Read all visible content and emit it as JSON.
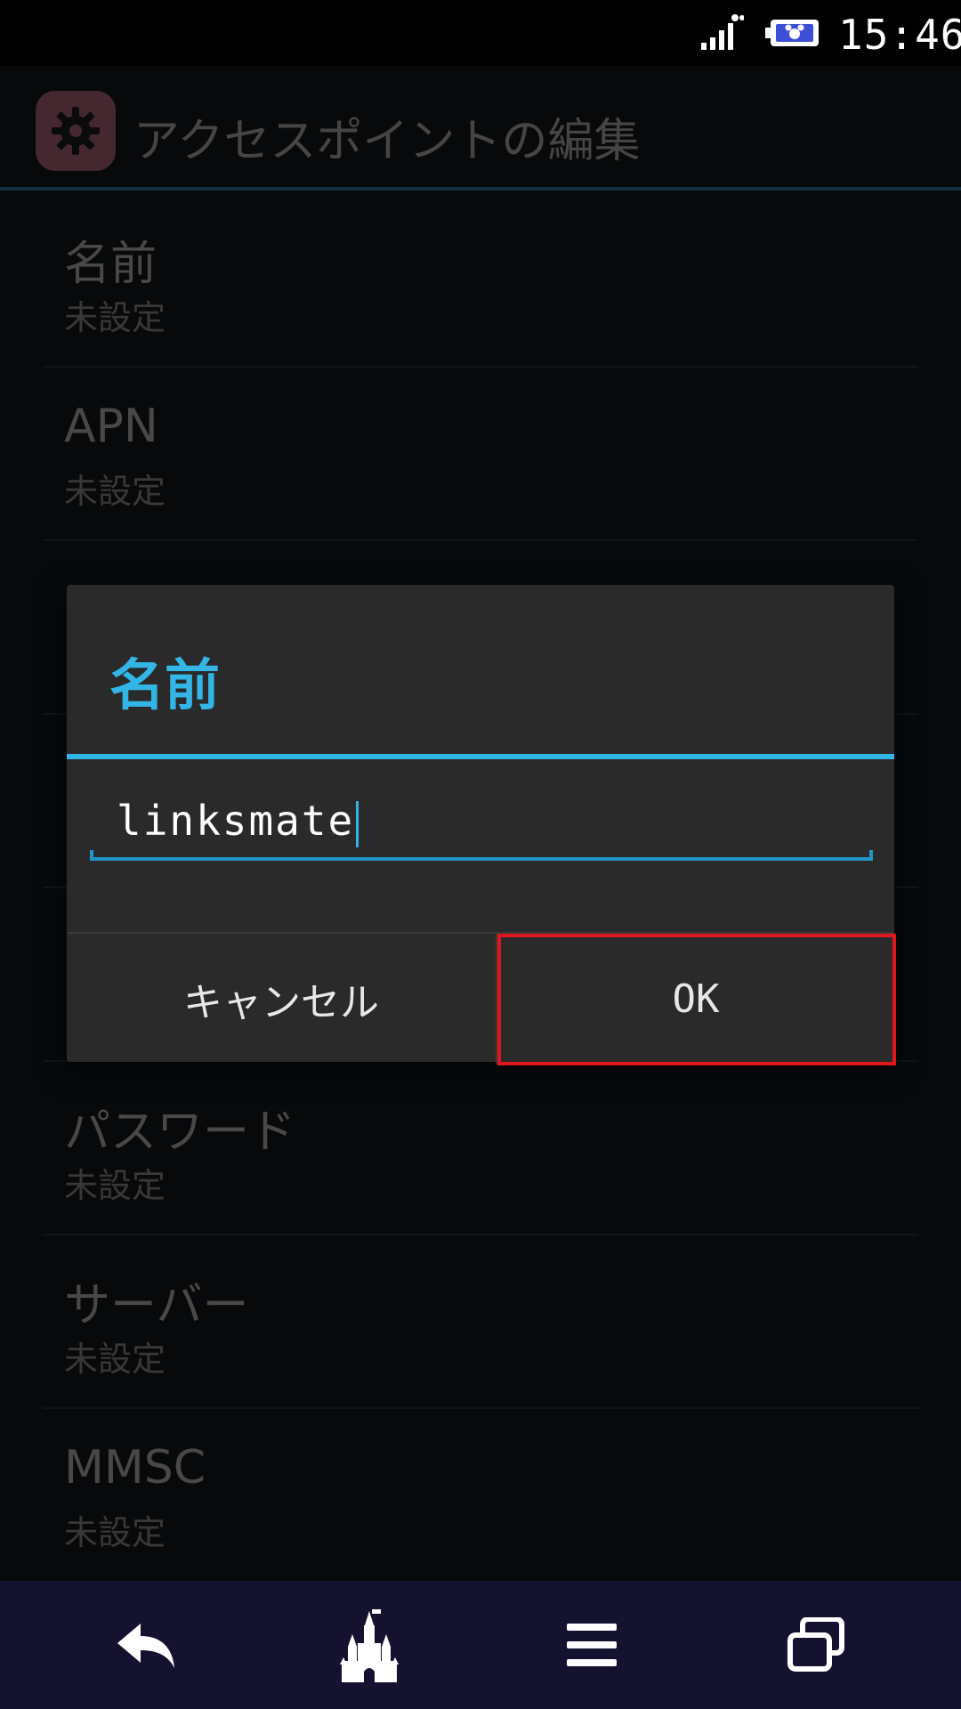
{
  "status_bar": {
    "time": "15:46",
    "signal_icon": "signal-bars-icon",
    "battery_icon": "battery-icon"
  },
  "action_bar": {
    "icon": "gear-icon",
    "title": "アクセスポイントの編集"
  },
  "preferences": [
    {
      "title": "名前",
      "summary": "未設定"
    },
    {
      "title": "APN",
      "summary": "未設定"
    },
    {
      "title": "",
      "summary": ""
    },
    {
      "title": "",
      "summary": ""
    },
    {
      "title": "",
      "summary": ""
    },
    {
      "title": "パスワード",
      "summary": "未設定"
    },
    {
      "title": "サーバー",
      "summary": "未設定"
    },
    {
      "title": "MMSC",
      "summary": "未設定"
    }
  ],
  "dialog": {
    "title": "名前",
    "input_value": "linksmate",
    "cancel_label": "キャンセル",
    "ok_label": "OK"
  },
  "nav_bar": {
    "back_icon": "back-arrow-icon",
    "home_icon": "castle-home-icon",
    "menu_icon": "menu-icon",
    "recent_icon": "recent-apps-icon"
  },
  "colors": {
    "accent": "#33b5e5",
    "highlight_box": "#e0161d",
    "navbar": "#14122e"
  }
}
